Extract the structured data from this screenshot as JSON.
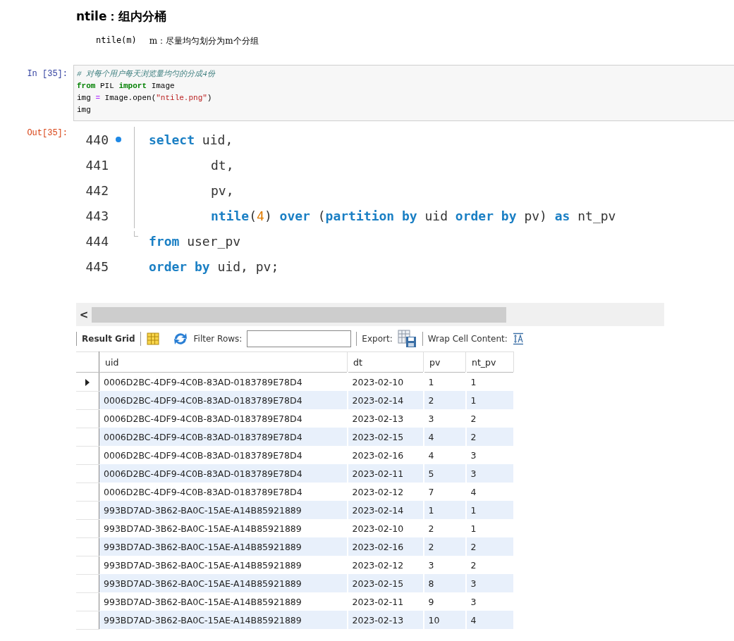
{
  "heading": "ntile：组内分桶",
  "note": {
    "syntax": "ntile(m)",
    "description": "m：尽量均匀划分为m个分组"
  },
  "input_cell": {
    "prompt": "In  [35]:",
    "lines": [
      [
        {
          "kind": "comment",
          "text": "# 对每个用户每天浏览量均匀的分成4份"
        }
      ],
      [
        {
          "kind": "keyword",
          "text": "from"
        },
        {
          "kind": "plain",
          "text": " PIL "
        },
        {
          "kind": "keyword",
          "text": "import"
        },
        {
          "kind": "plain",
          "text": " Image"
        }
      ],
      [
        {
          "kind": "plain",
          "text": "img "
        },
        {
          "kind": "operator",
          "text": "="
        },
        {
          "kind": "plain",
          "text": " Image.open("
        },
        {
          "kind": "string",
          "text": "\"ntile.png\""
        },
        {
          "kind": "plain",
          "text": ")"
        }
      ],
      [
        {
          "kind": "plain",
          "text": "img"
        }
      ]
    ]
  },
  "output_cell": {
    "prompt": "Out[35]:",
    "sql_lines": [
      {
        "number": "440",
        "breakpoint": true,
        "tokens": [
          {
            "kind": "keyword",
            "text": "select"
          },
          {
            "kind": "plain",
            "text": " uid,"
          }
        ]
      },
      {
        "number": "441",
        "breakpoint": false,
        "indented": true,
        "tokens": [
          {
            "kind": "plain",
            "text": "dt,"
          }
        ]
      },
      {
        "number": "442",
        "breakpoint": false,
        "indented": true,
        "tokens": [
          {
            "kind": "plain",
            "text": "pv,"
          }
        ]
      },
      {
        "number": "443",
        "breakpoint": false,
        "indented": true,
        "tokens": [
          {
            "kind": "keyword",
            "text": "ntile"
          },
          {
            "kind": "plain",
            "text": "("
          },
          {
            "kind": "number",
            "text": "4"
          },
          {
            "kind": "plain",
            "text": ") "
          },
          {
            "kind": "keyword",
            "text": "over"
          },
          {
            "kind": "plain",
            "text": " ("
          },
          {
            "kind": "keyword",
            "text": "partition by"
          },
          {
            "kind": "plain",
            "text": " uid "
          },
          {
            "kind": "keyword",
            "text": "order by"
          },
          {
            "kind": "plain",
            "text": " pv) "
          },
          {
            "kind": "keyword",
            "text": "as"
          },
          {
            "kind": "plain",
            "text": " nt_pv"
          }
        ]
      },
      {
        "number": "444",
        "breakpoint": false,
        "tokens": [
          {
            "kind": "keyword",
            "text": "from"
          },
          {
            "kind": "plain",
            "text": " user_pv"
          }
        ]
      },
      {
        "number": "445",
        "breakpoint": false,
        "tokens": [
          {
            "kind": "keyword",
            "text": "order by"
          },
          {
            "kind": "plain",
            "text": " uid, pv;"
          }
        ]
      }
    ],
    "result_grid": {
      "scroll_left": "<",
      "toolbar": {
        "title": "Result Grid",
        "filter_label": "Filter Rows:",
        "export_label": "Export:",
        "wrap_label": "Wrap Cell Content:"
      },
      "columns": [
        "uid",
        "dt",
        "pv",
        "nt_pv"
      ],
      "rows": [
        {
          "selected": true,
          "cells": [
            "0006D2BC-4DF9-4C0B-83AD-0183789E78D4",
            "2023-02-10",
            "1",
            "1"
          ]
        },
        {
          "selected": false,
          "cells": [
            "0006D2BC-4DF9-4C0B-83AD-0183789E78D4",
            "2023-02-14",
            "2",
            "1"
          ]
        },
        {
          "selected": false,
          "cells": [
            "0006D2BC-4DF9-4C0B-83AD-0183789E78D4",
            "2023-02-13",
            "3",
            "2"
          ]
        },
        {
          "selected": false,
          "cells": [
            "0006D2BC-4DF9-4C0B-83AD-0183789E78D4",
            "2023-02-15",
            "4",
            "2"
          ]
        },
        {
          "selected": false,
          "cells": [
            "0006D2BC-4DF9-4C0B-83AD-0183789E78D4",
            "2023-02-16",
            "4",
            "3"
          ]
        },
        {
          "selected": false,
          "cells": [
            "0006D2BC-4DF9-4C0B-83AD-0183789E78D4",
            "2023-02-11",
            "5",
            "3"
          ]
        },
        {
          "selected": false,
          "cells": [
            "0006D2BC-4DF9-4C0B-83AD-0183789E78D4",
            "2023-02-12",
            "7",
            "4"
          ]
        },
        {
          "selected": false,
          "cells": [
            "993BD7AD-3B62-BA0C-15AE-A14B85921889",
            "2023-02-14",
            "1",
            "1"
          ]
        },
        {
          "selected": false,
          "cells": [
            "993BD7AD-3B62-BA0C-15AE-A14B85921889",
            "2023-02-10",
            "2",
            "1"
          ]
        },
        {
          "selected": false,
          "cells": [
            "993BD7AD-3B62-BA0C-15AE-A14B85921889",
            "2023-02-16",
            "2",
            "2"
          ]
        },
        {
          "selected": false,
          "cells": [
            "993BD7AD-3B62-BA0C-15AE-A14B85921889",
            "2023-02-12",
            "3",
            "2"
          ]
        },
        {
          "selected": false,
          "cells": [
            "993BD7AD-3B62-BA0C-15AE-A14B85921889",
            "2023-02-15",
            "8",
            "3"
          ]
        },
        {
          "selected": false,
          "cells": [
            "993BD7AD-3B62-BA0C-15AE-A14B85921889",
            "2023-02-11",
            "9",
            "3"
          ]
        },
        {
          "selected": false,
          "cells": [
            "993BD7AD-3B62-BA0C-15AE-A14B85921889",
            "2023-02-13",
            "10",
            "4"
          ]
        }
      ]
    }
  }
}
